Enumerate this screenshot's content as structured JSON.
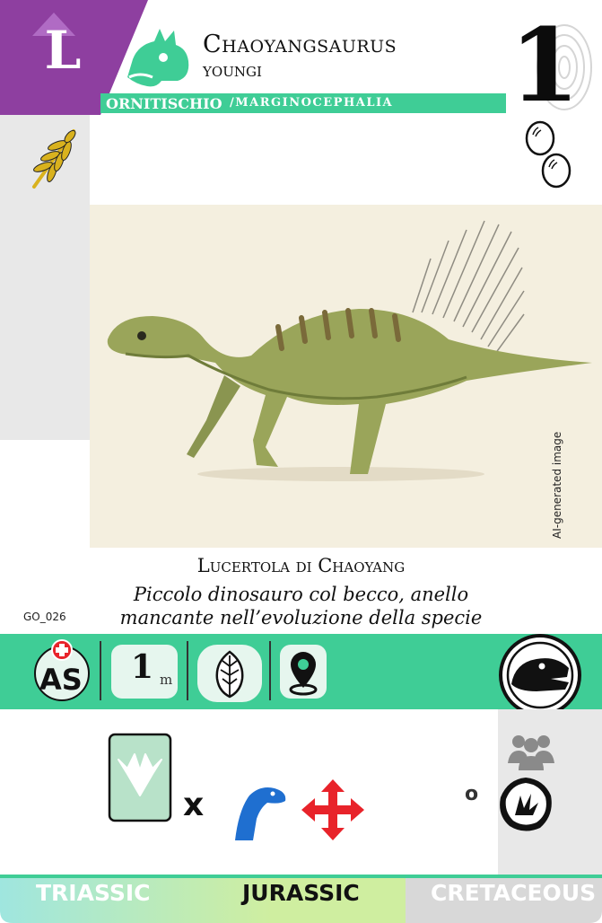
{
  "card": {
    "letter": "L",
    "name_line1": "Chaoyangsaurus",
    "name_line2": "youngi",
    "clade": "ORNITISCHIO",
    "subclade": "/MARGINOCEPHALIA",
    "number": "1",
    "code": "GO_026"
  },
  "art": {
    "ai_label": "AI-generated image"
  },
  "text": {
    "common_name": "Lucertola di Chaoyang",
    "description_line1": "Piccolo dinosauro col becco, anello",
    "description_line2": "mancante nell’evoluzione della specie"
  },
  "stats": {
    "region_badge": "AS",
    "size_value": "1",
    "size_unit": "m"
  },
  "actions": {
    "times": "x",
    "or": "o"
  },
  "periods": [
    "TRIASSIC",
    "JURASSIC",
    "CRETACEOUS"
  ],
  "colors": {
    "purple": "#8e3fa0",
    "green": "#3fcd96",
    "grey": "#e8e8e8",
    "red": "#e8232a",
    "blue": "#1f6fd0",
    "gold": "#d9b21e"
  }
}
